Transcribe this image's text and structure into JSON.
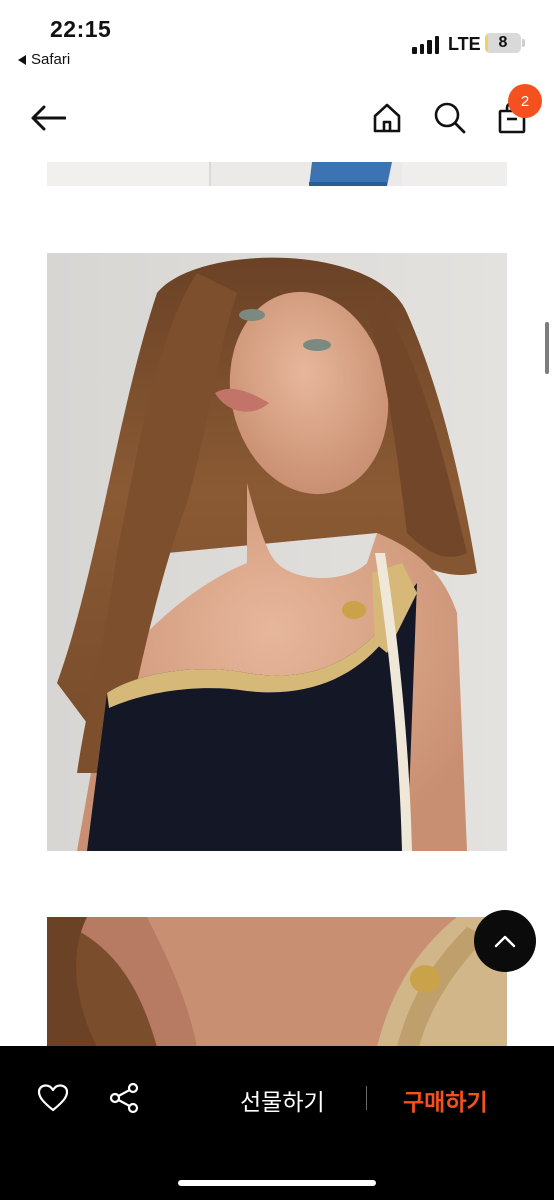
{
  "status_bar": {
    "time": "22:15",
    "back_app": "Safari",
    "network": "LTE",
    "battery_level": "8",
    "battery_fraction": 0.08
  },
  "nav": {
    "back_icon": "arrow-left-icon",
    "home_icon": "home-icon",
    "search_icon": "search-icon",
    "cart_icon": "shopping-bag-icon",
    "cart_count": "2"
  },
  "bottom_bar": {
    "like_icon": "heart-icon",
    "share_icon": "share-icon",
    "gift_label": "선물하기",
    "buy_label": "구매하기"
  },
  "colors": {
    "accent": "#f4511e",
    "bar_background": "#000000"
  },
  "scroll_top_icon": "chevron-up-icon"
}
